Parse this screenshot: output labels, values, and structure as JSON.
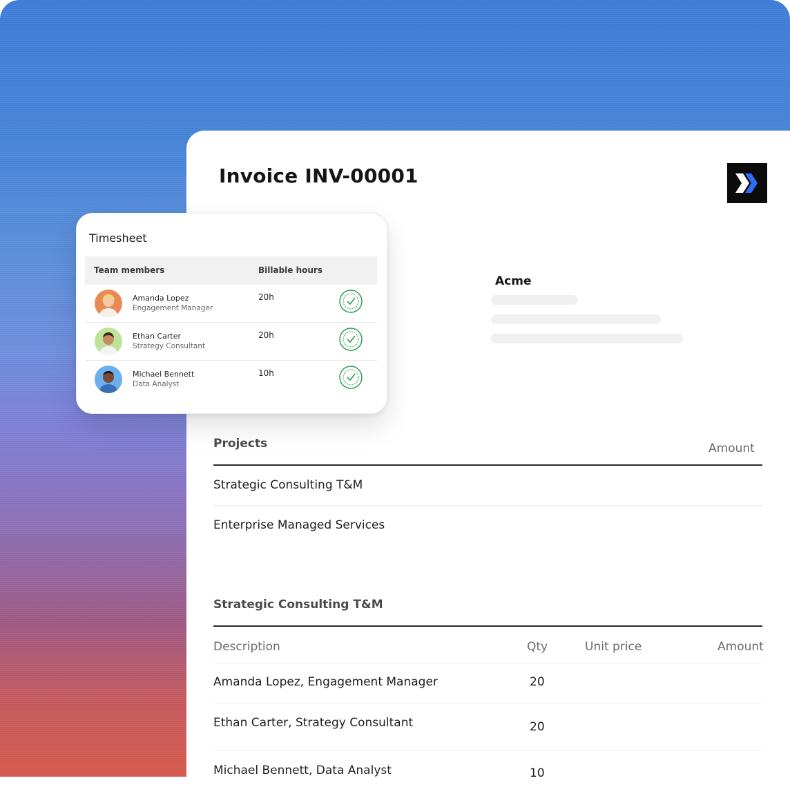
{
  "invoice": {
    "title": "Invoice INV-00001",
    "client_name": "Acme"
  },
  "projects": {
    "heading": "Projects",
    "amount_label": "Amount",
    "items": [
      "Strategic Consulting T&M",
      "Enterprise Managed Services"
    ]
  },
  "detail": {
    "heading": "Strategic Consulting T&M",
    "columns": {
      "description": "Description",
      "qty": "Qty",
      "unit_price": "Unit price",
      "amount": "Amount"
    },
    "rows": [
      {
        "description": "Amanda Lopez, Engagement Manager",
        "qty": "20"
      },
      {
        "description": "Ethan Carter, Strategy Consultant",
        "qty": "20"
      },
      {
        "description": "Michael Bennett, Data Analyst",
        "qty": "10"
      }
    ]
  },
  "timesheet": {
    "title": "Timesheet",
    "columns": {
      "members": "Team members",
      "hours": "Billable hours"
    },
    "rows": [
      {
        "name": "Amanda Lopez",
        "role": "Engagement Manager",
        "hours": "20h"
      },
      {
        "name": "Ethan Carter",
        "role": "Strategy Consultant",
        "hours": "20h"
      },
      {
        "name": "Michael Bennett",
        "role": "Data Analyst",
        "hours": "10h"
      }
    ],
    "approved_icon": "approved-stamp-icon"
  },
  "colors": {
    "logo_bg": "#0b0b0b",
    "logo_accent": "#2f6df6",
    "stamp_green": "#2e9e57"
  }
}
